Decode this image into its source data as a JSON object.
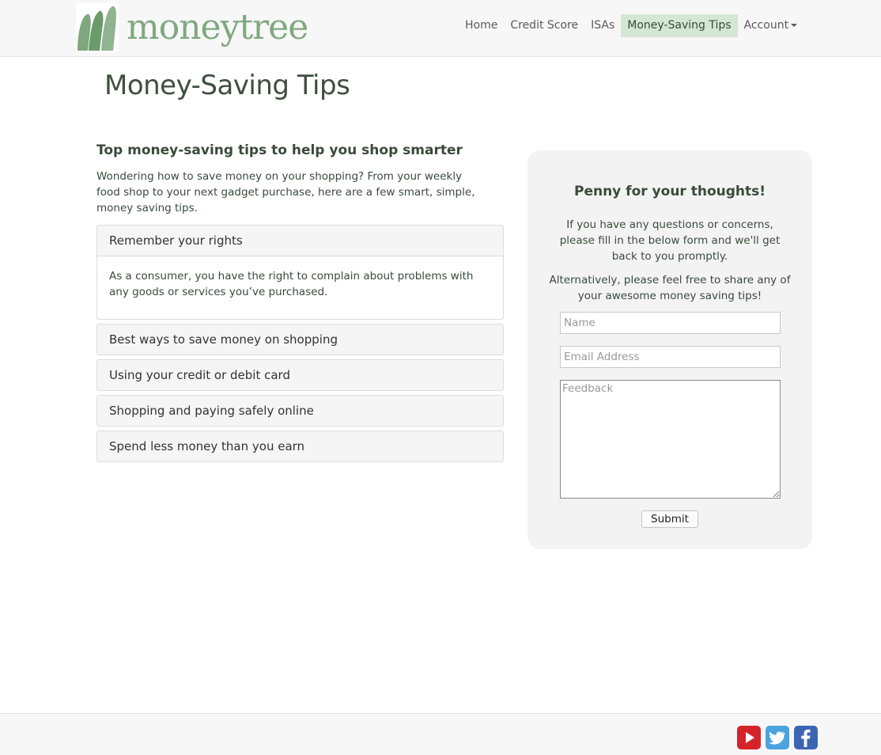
{
  "brand": {
    "name": "moneytree",
    "accent": "#7fa87f"
  },
  "nav": {
    "items": [
      {
        "label": "Home"
      },
      {
        "label": "Credit Score"
      },
      {
        "label": "ISAs"
      },
      {
        "label": "Money-Saving Tips",
        "active": true
      },
      {
        "label": "Account"
      }
    ]
  },
  "page": {
    "title": "Money-Saving Tips"
  },
  "tips": {
    "heading": "Top money-saving tips to help you shop smarter",
    "intro": "Wondering how to save money on your shopping? From your weekly food shop to your next gadget purchase, here are a few smart, simple, money saving tips.",
    "accordion": [
      {
        "title": "Remember your rights",
        "expanded": true,
        "body": "As a consumer, you have the right to complain about problems with any goods or services you’ve purchased."
      },
      {
        "title": "Best ways to save money on shopping",
        "expanded": false
      },
      {
        "title": "Using your credit or debit card",
        "expanded": false
      },
      {
        "title": "Shopping and paying safely online",
        "expanded": false
      },
      {
        "title": "Spend less money than you earn",
        "expanded": false
      }
    ]
  },
  "feedback_form": {
    "title": "Penny for your thoughts!",
    "text1": "If you have any questions or concerns, please fill in the below form and we'll get back to you promptly.",
    "text2": "Alternatively, please feel free to share any of your awesome money saving tips!",
    "name_placeholder": "Name",
    "email_placeholder": "Email Address",
    "feedback_placeholder": "Feedback",
    "submit_label": "Submit"
  },
  "footer": {
    "social": [
      {
        "icon": "youtube-icon",
        "color": "#d4242a"
      },
      {
        "icon": "twitter-icon",
        "color": "#4aa3df"
      },
      {
        "icon": "facebook-icon",
        "color": "#3b65b3"
      }
    ]
  }
}
